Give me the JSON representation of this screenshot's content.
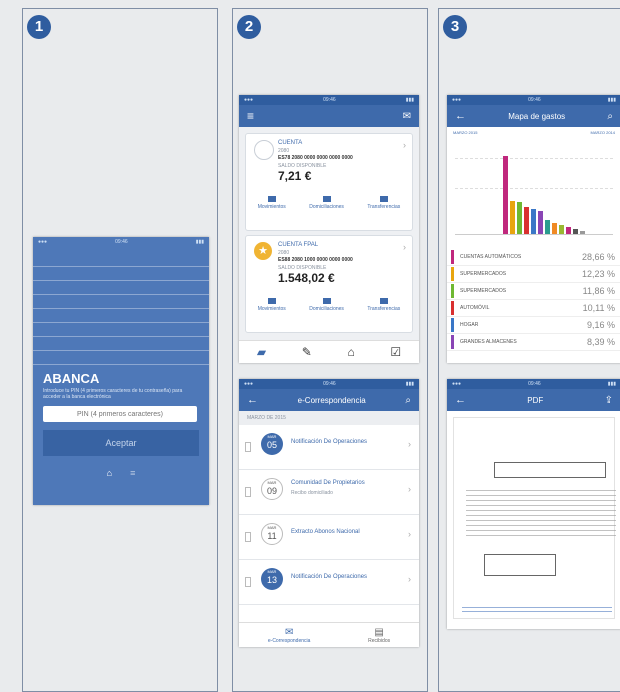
{
  "steps": [
    "1",
    "2",
    "3"
  ],
  "login": {
    "brand": "ABANCA",
    "desc": "Introduce tu PIN (4 primeros caracteres de tu contraseña) para acceder a la banca electrónica",
    "pin_placeholder": "PIN (4 primeros caracteres)",
    "accept_label": "Aceptar"
  },
  "accounts": {
    "items": [
      {
        "name": "CUENTA",
        "sub": "2080",
        "iban": "ES78 2080 0000 0000 0000 0000",
        "balance_label": "SALDO DISPONIBLE",
        "balance": "7,21 €",
        "actions": [
          "Movimientos",
          "Domiciliaciones",
          "Transferencias"
        ]
      },
      {
        "name": "CUENTA FPAL",
        "sub": "2080",
        "iban": "ES88 2080 1000 0000 0000 0000",
        "balance_label": "SALDO DISPONIBLE",
        "balance": "1.548,02 €",
        "actions": [
          "Movimientos",
          "Domiciliaciones",
          "Transferencias"
        ]
      }
    ]
  },
  "corr": {
    "title": "e-Correspondencia",
    "section": "MARZO DE 2015",
    "items": [
      {
        "month": "MAR",
        "day": "05",
        "title": "Notificación De Operaciones",
        "sub": "",
        "state": "read"
      },
      {
        "month": "MAR",
        "day": "09",
        "title": "Comunidad De Propietarios",
        "sub": "Recibo domiciliado",
        "state": "new"
      },
      {
        "month": "MAR",
        "day": "11",
        "title": "Extracto Abonos Nacional",
        "sub": "",
        "state": "new"
      },
      {
        "month": "MAR",
        "day": "13",
        "title": "Notificación De Operaciones",
        "sub": "",
        "state": "read"
      }
    ],
    "bottom": [
      "e-Correspondencia",
      "Recibidos"
    ]
  },
  "analytics": {
    "title": "Mapa de gastos",
    "period_left": "MARZO 2015",
    "period_right": "MARZO 2014",
    "categories": [
      {
        "name": "CUENTAS AUTOMÁTICOS",
        "pct": "28,66 %",
        "color": "#c0287d"
      },
      {
        "name": "SUPERMERCADOS",
        "pct": "12,23 %",
        "color": "#e8a50f"
      },
      {
        "name": "SUPERMERCADOS",
        "pct": "11,86 %",
        "color": "#6fb832"
      },
      {
        "name": "AUTOMÓVIL",
        "pct": "10,11 %",
        "color": "#d93030"
      },
      {
        "name": "HOGAR",
        "pct": "9,16 %",
        "color": "#3a77c7"
      },
      {
        "name": "GRANDES ALMACENES",
        "pct": "8,39 %",
        "color": "#8a45b5"
      }
    ]
  },
  "pdf": {
    "title": "PDF"
  }
}
